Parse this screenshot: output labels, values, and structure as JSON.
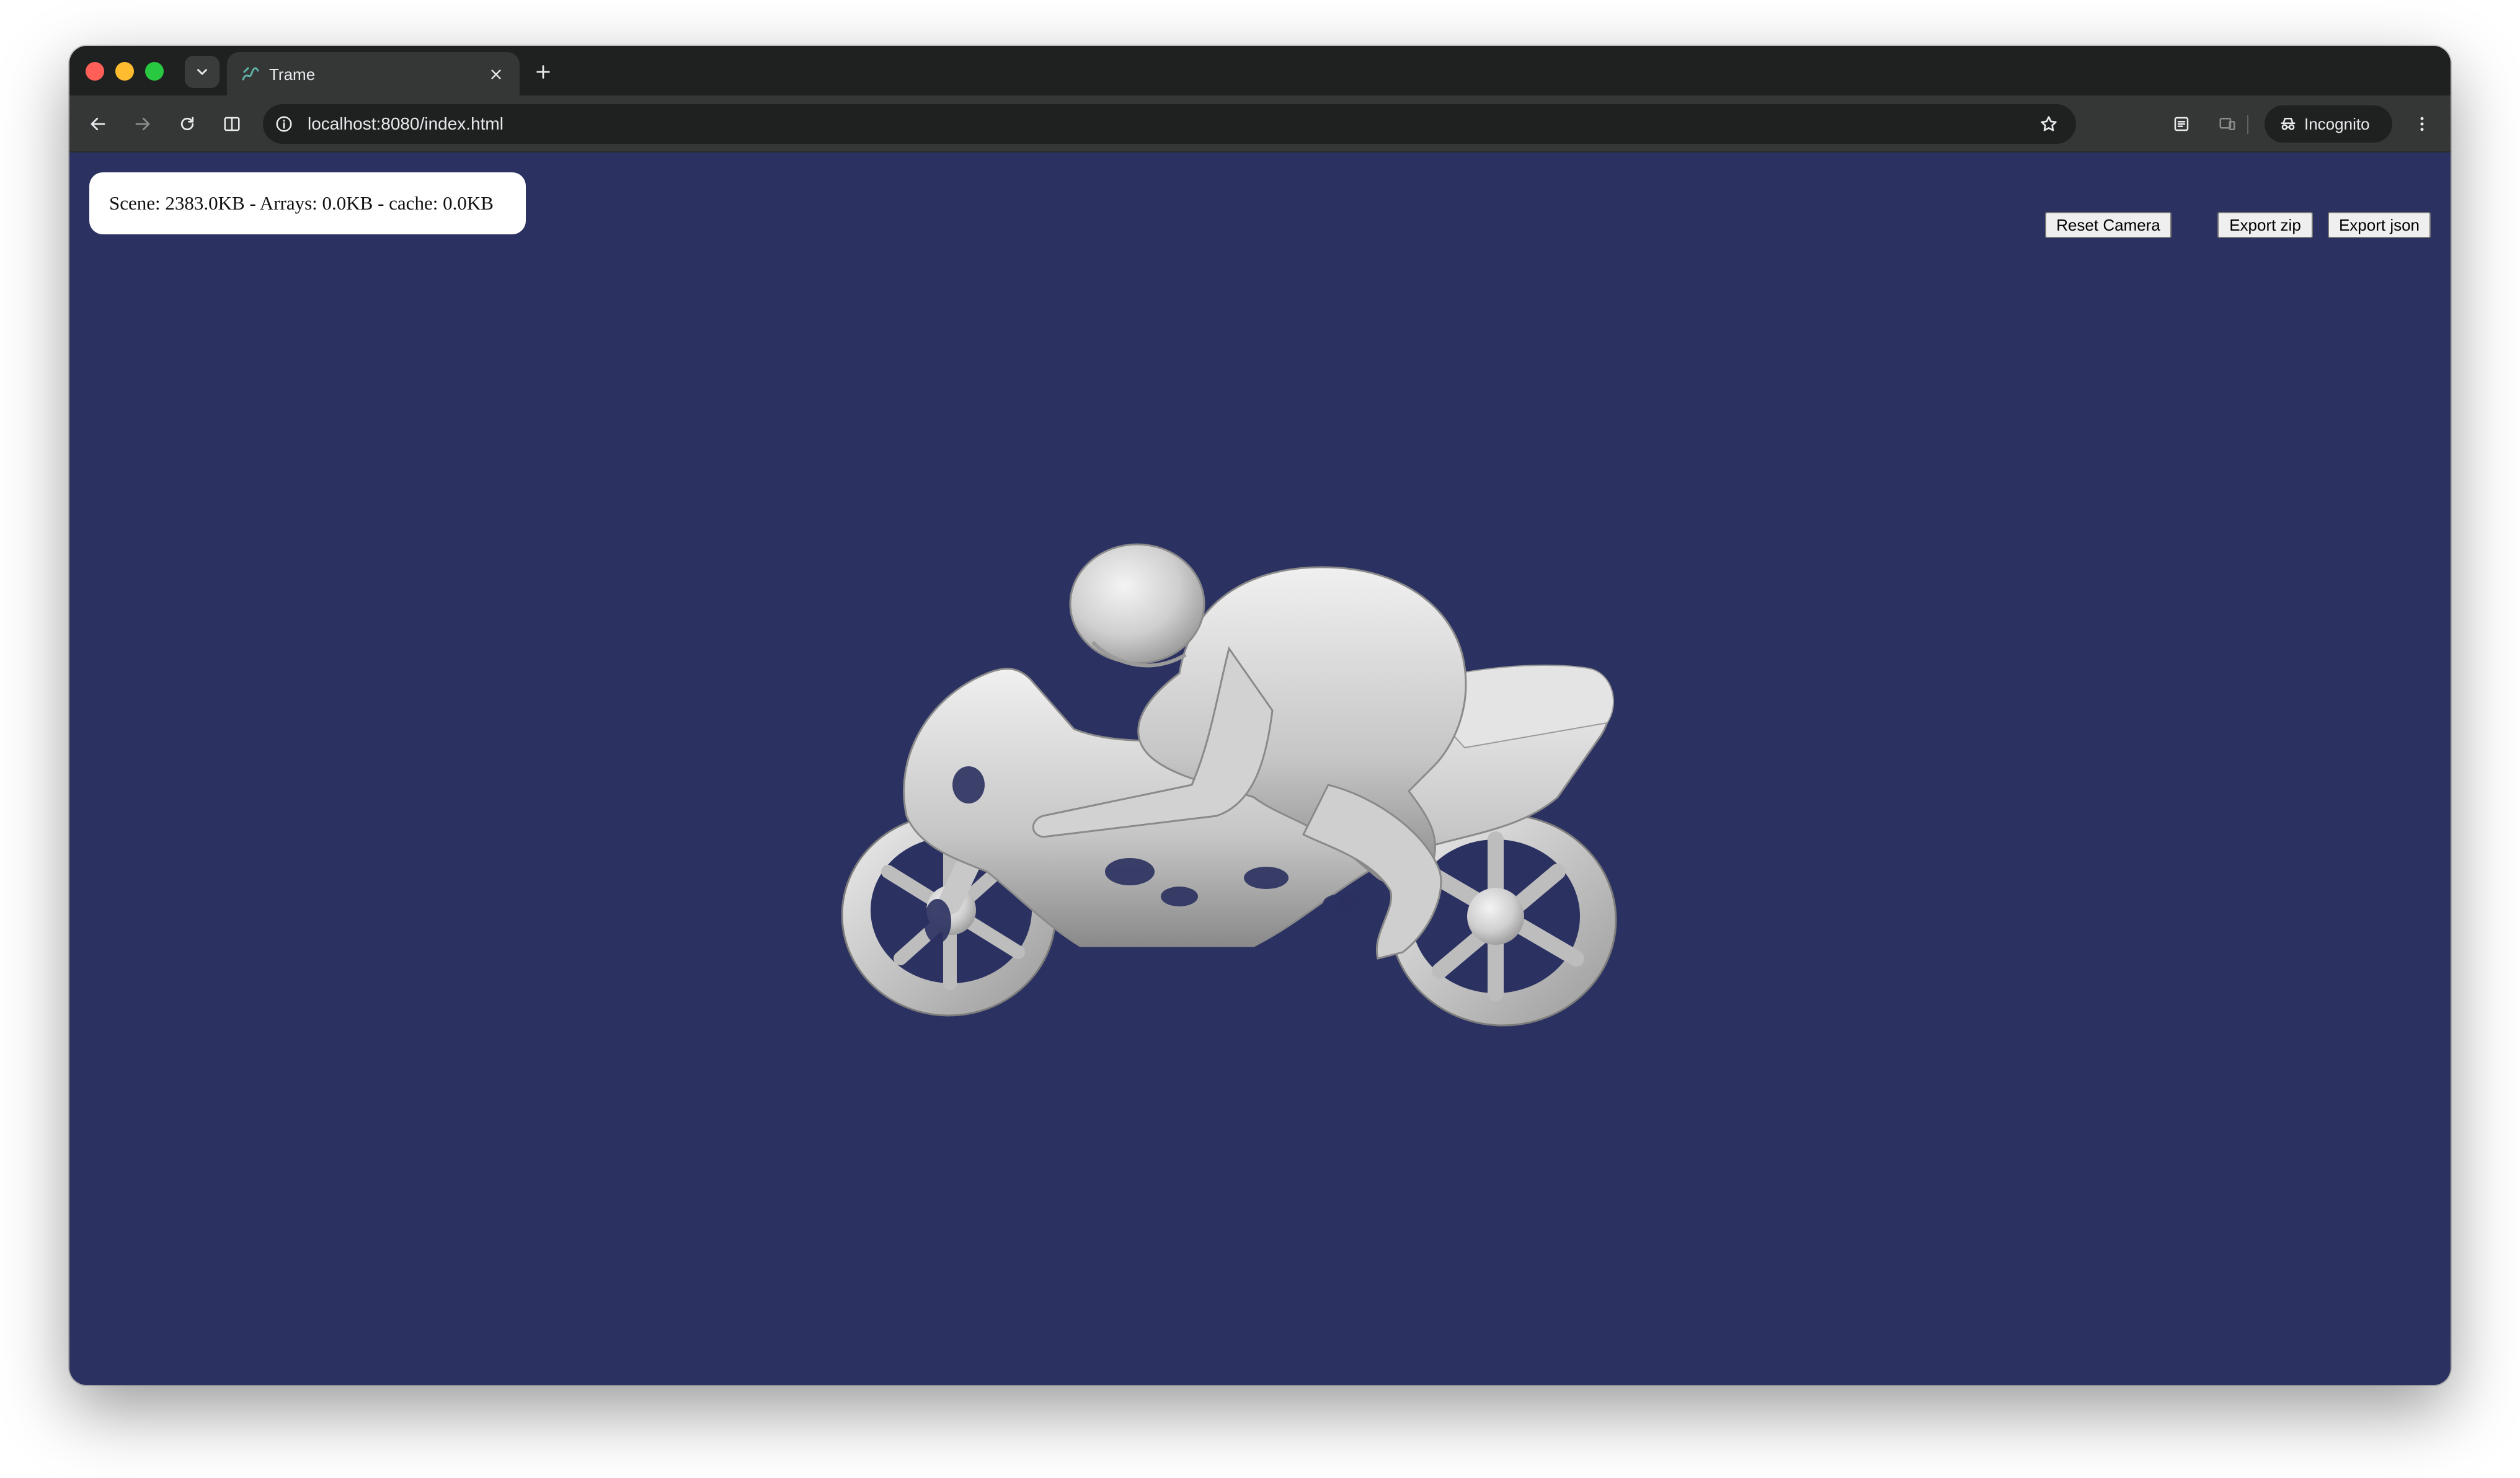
{
  "browser": {
    "tab": {
      "title": "Trame",
      "favicon": "trame-logo-icon"
    },
    "address_bar": {
      "url": "localhost:8080/index.html"
    },
    "profile_label": "Incognito"
  },
  "page": {
    "scene_info": "Scene: 2383.0KB - Arrays: 0.0KB - cache: 0.0KB",
    "buttons": {
      "reset_camera": "Reset Camera",
      "export_zip": "Export zip",
      "export_json": "Export json"
    },
    "render": {
      "background_color": "#2b3160",
      "model_color": "#d8d8d8",
      "model_description_icon": "motorbike-rider-mesh-icon"
    }
  }
}
